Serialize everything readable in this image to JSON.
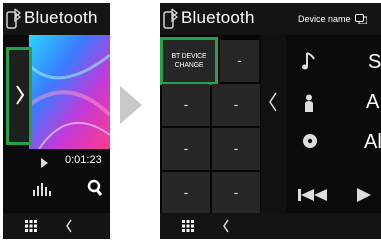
{
  "left_screen": {
    "title": "Bluetooth",
    "time": "0:01:23"
  },
  "right_screen": {
    "title": "Bluetooth",
    "device_name_label": "Device name",
    "bt_device_change_line1": "BT DEVICE",
    "bt_device_change_line2": "CHANGE",
    "empty_slot": "-",
    "partial_labels": [
      "S",
      "A",
      "Al"
    ]
  },
  "colors": {
    "highlight": "#22a24a"
  },
  "arrow": "›"
}
